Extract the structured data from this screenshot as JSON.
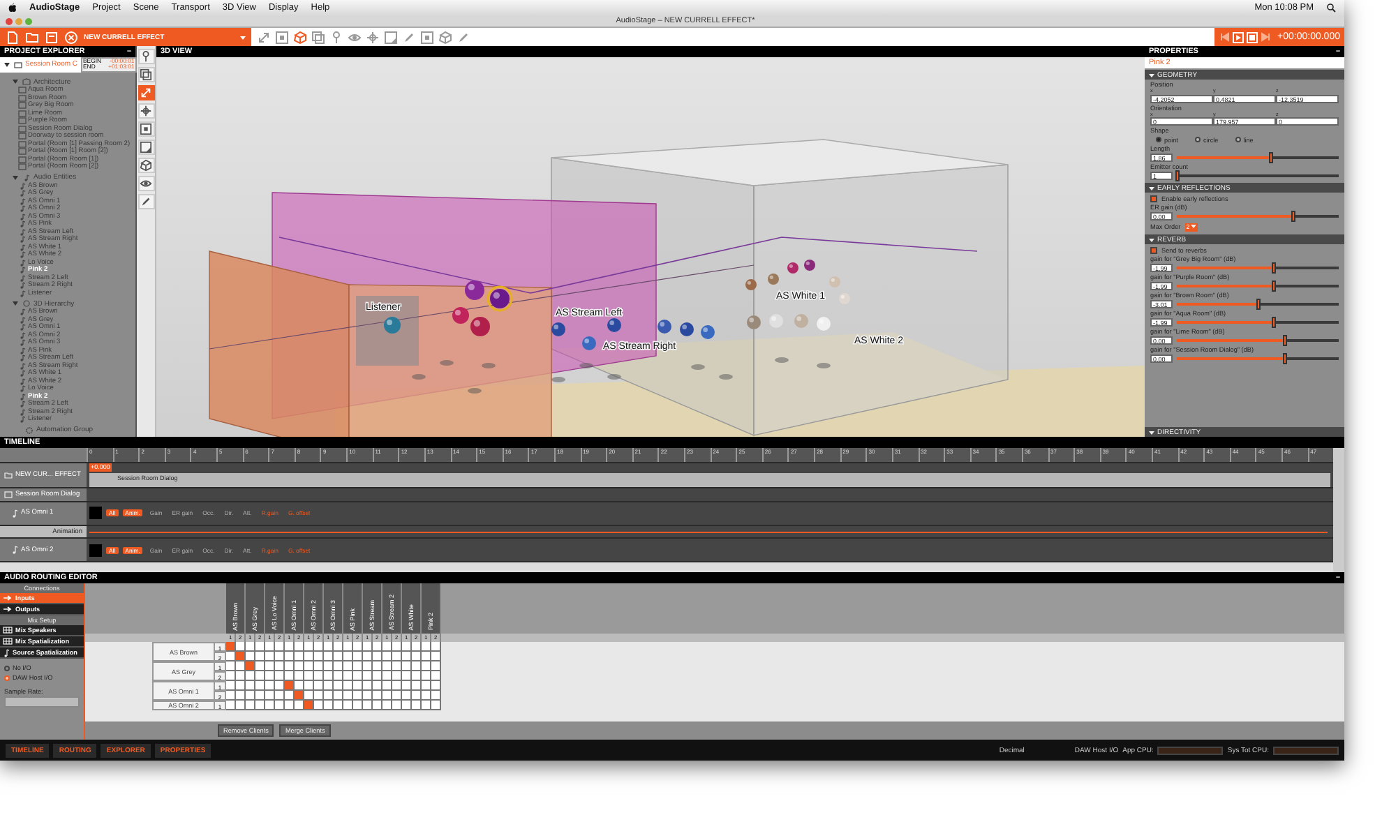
{
  "menubar": {
    "app": "AudioStage",
    "menus": [
      "Project",
      "Scene",
      "Transport",
      "3D View",
      "Display",
      "Help"
    ],
    "clock": "Mon 10:08 PM"
  },
  "window": {
    "title": "AudioStage – NEW CURRELL EFFECT*"
  },
  "toolbar": {
    "project": "NEW CURRELL EFFECT",
    "timecode": "+00:00:00.000"
  },
  "project_explorer": {
    "title": "PROJECT EXPLORER",
    "collapse": "–",
    "session": {
      "name": "Session Room C",
      "fields": [
        {
          "label": "BEGIN",
          "value": "-00:00:01"
        },
        {
          "label": "END",
          "value": "+01:03:01"
        }
      ]
    },
    "groups": [
      {
        "label": "Architecture",
        "kind": "architecture",
        "expanded": true,
        "children": [
          {
            "label": "Aqua Room",
            "selected": false
          },
          {
            "label": "Brown Room",
            "selected": false
          },
          {
            "label": "Grey Big Room",
            "selected": false
          },
          {
            "label": "Lime Room",
            "selected": false
          },
          {
            "label": "Purple Room",
            "selected": false
          },
          {
            "label": "Session Room Dialog",
            "selected": false
          },
          {
            "label": "Doorway to session room",
            "selected": false
          },
          {
            "label": "Portal (Room [1] Passing Room 2)",
            "selected": false
          },
          {
            "label": "Portal (Room [1] Room [2])",
            "selected": false
          },
          {
            "label": "Portal (Room Room [1])",
            "selected": false
          },
          {
            "label": "Portal (Room Room [2])",
            "selected": false
          }
        ]
      },
      {
        "label": "Audio Entities",
        "kind": "audio",
        "expanded": true,
        "children": [
          {
            "label": "AS Brown",
            "selected": false
          },
          {
            "label": "AS Grey",
            "selected": false
          },
          {
            "label": "AS Omni 1",
            "selected": false
          },
          {
            "label": "AS Omni 2",
            "selected": false
          },
          {
            "label": "AS Omni 3",
            "selected": false
          },
          {
            "label": "AS Pink",
            "selected": false
          },
          {
            "label": "AS Stream Left",
            "selected": false
          },
          {
            "label": "AS Stream Right",
            "selected": false
          },
          {
            "label": "AS White 1",
            "selected": false
          },
          {
            "label": "AS White 2",
            "selected": false
          },
          {
            "label": "Lo Voice",
            "selected": false
          },
          {
            "label": "Pink 2",
            "selected": true
          },
          {
            "label": "Stream 2 Left",
            "selected": false
          },
          {
            "label": "Stream 2 Right",
            "selected": false
          },
          {
            "label": "Listener",
            "selected": false
          }
        ]
      },
      {
        "label": "3D Hierarchy",
        "kind": "hierarchy",
        "expanded": true,
        "children": [
          {
            "label": "AS Brown",
            "selected": false
          },
          {
            "label": "AS Grey",
            "selected": false
          },
          {
            "label": "AS Omni 1",
            "selected": false
          },
          {
            "label": "AS Omni 2",
            "selected": false
          },
          {
            "label": "AS Omni 3",
            "selected": false
          },
          {
            "label": "AS Pink",
            "selected": false
          },
          {
            "label": "AS Stream Left",
            "selected": false
          },
          {
            "label": "AS Stream Right",
            "selected": false
          },
          {
            "label": "AS White 1",
            "selected": false
          },
          {
            "label": "AS White 2",
            "selected": false
          },
          {
            "label": "Lo Voice",
            "selected": false
          },
          {
            "label": "Pink 2",
            "selected": true
          },
          {
            "label": "Stream 2 Left",
            "selected": false
          },
          {
            "label": "Stream 2 Right",
            "selected": false
          },
          {
            "label": "Listener",
            "selected": false
          }
        ]
      }
    ],
    "footer": "Automation Group"
  },
  "tool_strip": [
    {
      "kind": "pin",
      "selected": false
    },
    {
      "kind": "layers",
      "selected": false
    },
    {
      "kind": "transform",
      "selected": true
    },
    {
      "kind": "axis",
      "selected": false
    },
    {
      "kind": "frame",
      "selected": false
    },
    {
      "kind": "corner",
      "selected": false
    },
    {
      "kind": "cube",
      "selected": false
    },
    {
      "kind": "eye",
      "selected": false
    },
    {
      "kind": "pencil",
      "selected": false
    }
  ],
  "view": {
    "title": "3D VIEW",
    "labels": [
      "Listener",
      "AS Stream Left",
      "AS Stream Right",
      "AS White 1",
      "AS White 2"
    ]
  },
  "properties": {
    "title": "PROPERTIES",
    "collapse": "–",
    "object": "Pink 2",
    "geometry": {
      "header": "GEOMETRY",
      "position_label": "Position",
      "position": [
        {
          "axis": "x",
          "value": "-4.2052"
        },
        {
          "axis": "y",
          "value": "0.4821"
        },
        {
          "axis": "z",
          "value": "-12.3519"
        }
      ],
      "orientation_label": "Orientation",
      "orientation": [
        {
          "axis": "x",
          "value": "0"
        },
        {
          "axis": "y",
          "value": "179.957"
        },
        {
          "axis": "z",
          "value": "0"
        }
      ],
      "shape_label": "Shape",
      "shapes": [
        {
          "label": "point",
          "selected": true
        },
        {
          "label": "circle",
          "selected": false
        },
        {
          "label": "line",
          "selected": false
        }
      ],
      "sliders": [
        {
          "label": "Length",
          "value": "1.86",
          "level": 0.58
        },
        {
          "label": "Emitter count",
          "value": "1",
          "level": 0.0
        }
      ]
    },
    "early_reflections": {
      "header": "EARLY REFLECTIONS",
      "enable_label": "Enable early reflections",
      "checked": true,
      "gain": {
        "label": "ER gain (dB)",
        "value": "0.00",
        "level": 0.72
      },
      "max_order_label": "Max Order",
      "max_order": "2"
    },
    "reverb": {
      "header": "REVERB",
      "send_label": "Send to reverbs",
      "checked": true,
      "gains": [
        {
          "label": "gain for \"Grey Big Room\" (dB)",
          "value": "-1.99",
          "level": 0.6
        },
        {
          "label": "gain for \"Purple Room\" (dB)",
          "value": "-1.99",
          "level": 0.6
        },
        {
          "label": "gain for \"Brown Room\" (dB)",
          "value": "-3.01",
          "level": 0.5
        },
        {
          "label": "gain for \"Aqua Room\" (dB)",
          "value": "-1.99",
          "level": 0.6
        },
        {
          "label": "gain for \"Lime Room\" (dB)",
          "value": "0.00",
          "level": 0.67
        },
        {
          "label": "gain for \"Session Room Dialog\" (dB)",
          "value": "0.00",
          "level": 0.67
        }
      ]
    },
    "directivity": {
      "header": "DIRECTIVITY"
    }
  },
  "timeline": {
    "title": "TIMELINE",
    "ruler": [
      "0",
      "1",
      "2",
      "3",
      "4",
      "5",
      "6",
      "7",
      "8",
      "9",
      "10",
      "11",
      "12",
      "13",
      "14",
      "15",
      "16",
      "17",
      "18",
      "19",
      "20",
      "21",
      "22",
      "23",
      "24",
      "25",
      "26",
      "27",
      "28",
      "29",
      "30",
      "31",
      "32",
      "33",
      "34",
      "35",
      "36",
      "37",
      "38",
      "39",
      "40",
      "41",
      "42",
      "43",
      "44",
      "45",
      "46",
      "47"
    ],
    "playhead": "+0.000",
    "tracks": [
      {
        "kind": "project",
        "name": "NEW CUR... EFFECT",
        "region": "Session Room Dialog"
      },
      {
        "kind": "room",
        "name": "Session Room Dialog"
      },
      {
        "kind": "source",
        "name": "AS Omni 1",
        "chips": [
          {
            "label": "All",
            "kind": "toggle",
            "on": true
          },
          {
            "label": "Anim.",
            "kind": "toggle",
            "on": true
          },
          {
            "label": "Gain",
            "kind": "toggle",
            "on": false
          },
          {
            "label": "ER gain",
            "kind": "toggle",
            "on": false
          },
          {
            "label": "Occ.",
            "kind": "toggle",
            "on": false
          },
          {
            "label": "Dir.",
            "kind": "toggle",
            "on": false
          },
          {
            "label": "Att.",
            "kind": "toggle",
            "on": false
          },
          {
            "label": "R.gain",
            "kind": "param",
            "on": false
          },
          {
            "label": "G. offset",
            "kind": "param",
            "on": false
          }
        ]
      },
      {
        "kind": "animation",
        "name": "Animation"
      },
      {
        "kind": "source",
        "name": "AS Omni 2",
        "chips": [
          {
            "label": "All",
            "kind": "toggle",
            "on": true
          },
          {
            "label": "Anim.",
            "kind": "toggle",
            "on": true
          },
          {
            "label": "Gain",
            "kind": "toggle",
            "on": false
          },
          {
            "label": "ER gain",
            "kind": "toggle",
            "on": false
          },
          {
            "label": "Occ.",
            "kind": "toggle",
            "on": false
          },
          {
            "label": "Dir.",
            "kind": "toggle",
            "on": false
          },
          {
            "label": "Att.",
            "kind": "toggle",
            "on": false
          },
          {
            "label": "R.gain",
            "kind": "param",
            "on": false
          },
          {
            "label": "G. offset",
            "kind": "param",
            "on": false
          }
        ]
      }
    ]
  },
  "routing": {
    "title": "AUDIO ROUTING EDITOR",
    "collapse": "–",
    "sections": [
      {
        "header": "Connections",
        "items": [
          {
            "label": "Inputs",
            "kind": "arrow",
            "selected": true
          },
          {
            "label": "Outputs",
            "kind": "arrow",
            "selected": false
          }
        ]
      },
      {
        "header": "Mix Setup",
        "items": [
          {
            "label": "Mix Speakers",
            "kind": "grid",
            "selected": false
          },
          {
            "label": "Mix Spatialization",
            "kind": "grid",
            "selected": false
          },
          {
            "label": "Source Spatialization",
            "kind": "note",
            "selected": false
          }
        ]
      }
    ],
    "io_modes": [
      {
        "label": "No I/O",
        "selected": false
      },
      {
        "label": "DAW Host I/O",
        "selected": true
      }
    ],
    "sample_rate_label": "Sample Rate:",
    "columns": [
      {
        "name": "AS Brown",
        "channels": [
          "1",
          "2"
        ]
      },
      {
        "name": "AS Grey",
        "channels": [
          "1",
          "2"
        ]
      },
      {
        "name": "AS Lo Voice",
        "channels": [
          "1",
          "2"
        ]
      },
      {
        "name": "AS Omni 1",
        "channels": [
          "1",
          "2"
        ]
      },
      {
        "name": "AS Omni 2",
        "channels": [
          "1",
          "2"
        ]
      },
      {
        "name": "AS Omni 3",
        "channels": [
          "1",
          "2"
        ]
      },
      {
        "name": "AS Pink",
        "channels": [
          "1",
          "2"
        ]
      },
      {
        "name": "AS Stream",
        "channels": [
          "1",
          "2"
        ]
      },
      {
        "name": "AS Stream 2",
        "channels": [
          "1",
          "2"
        ]
      },
      {
        "name": "AS White",
        "channels": [
          "1",
          "2"
        ]
      },
      {
        "name": "Pink 2",
        "channels": [
          "1",
          "2"
        ]
      }
    ],
    "rows": [
      {
        "name": "AS Brown",
        "channels": [
          {
            "label": "1",
            "cells": [
              true,
              false,
              false,
              false,
              false,
              false,
              false,
              false,
              false,
              false,
              false,
              false,
              false,
              false,
              false,
              false,
              false,
              false,
              false,
              false,
              false,
              false
            ]
          },
          {
            "label": "2",
            "cells": [
              false,
              true,
              false,
              false,
              false,
              false,
              false,
              false,
              false,
              false,
              false,
              false,
              false,
              false,
              false,
              false,
              false,
              false,
              false,
              false,
              false,
              false
            ]
          }
        ]
      },
      {
        "name": "AS Grey",
        "channels": [
          {
            "label": "1",
            "cells": [
              false,
              false,
              true,
              false,
              false,
              false,
              false,
              false,
              false,
              false,
              false,
              false,
              false,
              false,
              false,
              false,
              false,
              false,
              false,
              false,
              false,
              false
            ]
          },
          {
            "label": "2",
            "cells": [
              false,
              false,
              false,
              false,
              false,
              false,
              false,
              false,
              false,
              false,
              false,
              false,
              false,
              false,
              false,
              false,
              false,
              false,
              false,
              false,
              false,
              false
            ]
          }
        ]
      },
      {
        "name": "AS Omni 1",
        "channels": [
          {
            "label": "1",
            "cells": [
              false,
              false,
              false,
              false,
              false,
              false,
              true,
              false,
              false,
              false,
              false,
              false,
              false,
              false,
              false,
              false,
              false,
              false,
              false,
              false,
              false,
              false
            ]
          },
          {
            "label": "2",
            "cells": [
              false,
              false,
              false,
              false,
              false,
              false,
              false,
              true,
              false,
              false,
              false,
              false,
              false,
              false,
              false,
              false,
              false,
              false,
              false,
              false,
              false,
              false
            ]
          }
        ]
      },
      {
        "name": "AS Omni 2",
        "channels": [
          {
            "label": "1",
            "cells": [
              false,
              false,
              false,
              false,
              false,
              false,
              false,
              false,
              true,
              false,
              false,
              false,
              false,
              false,
              false,
              false,
              false,
              false,
              false,
              false,
              false,
              false
            ]
          }
        ]
      }
    ],
    "buttons": [
      "Remove Clients",
      "Merge Clients"
    ]
  },
  "bottom_bar": {
    "tabs": [
      {
        "label": "TIMELINE"
      },
      {
        "label": "ROUTING"
      },
      {
        "label": "EXPLORER"
      },
      {
        "label": "PROPERTIES"
      }
    ],
    "number_format": "Decimal",
    "io": "DAW Host I/O",
    "app_cpu": "App CPU:",
    "sys_cpu": "Sys Tot CPU:"
  }
}
